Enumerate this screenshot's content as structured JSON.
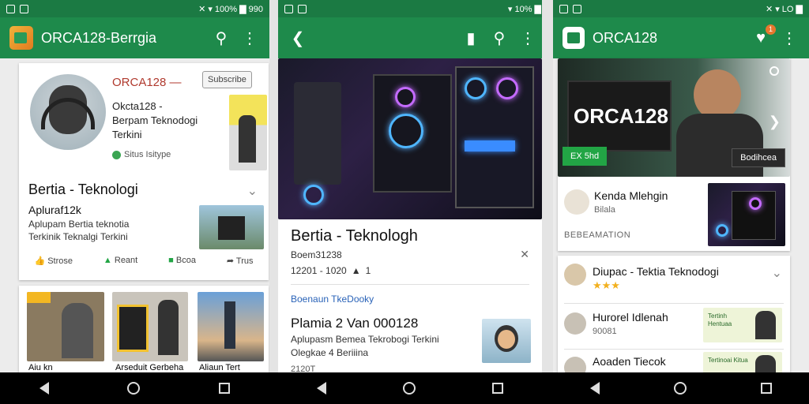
{
  "status": {
    "left_time": "",
    "p1_right": "✕ ▾ 100% ▇ 990",
    "p2_right": "▾ 10% ▇",
    "p3_right": "✕ ▾ LO ▇"
  },
  "panel1": {
    "app_title": "ORCA128-Berrgia",
    "profile": {
      "name": "ORCA128 —",
      "follow_label": "Subscribe",
      "line1": "Okcta128 -",
      "line2": "Berpam Teknodogi",
      "line3": "Terkini",
      "link": "Situs Isitype"
    },
    "headline": "Bertia - Teknologi",
    "article": {
      "title": "Apluraf12k",
      "line1": "Aplupam Bertia teknotia",
      "line2": "Terkinik Teknalgi Terkini"
    },
    "actions": [
      {
        "label": "Strose"
      },
      {
        "label": "Reant"
      },
      {
        "label": "Bcoa"
      },
      {
        "label": "Trus"
      }
    ],
    "tiles": [
      {
        "caption": "Aiu kn"
      },
      {
        "caption": "Arseduit Gerbeha"
      },
      {
        "caption": "Aliaun Tert"
      }
    ]
  },
  "panel2": {
    "headline": "Bertia - Teknologh",
    "meta1": "Boem31238",
    "meta2": "12201 - 1020",
    "meta2_count": "1",
    "link": "Boenaun TkeDooky",
    "article": {
      "title": "Plamia 2 Van 000128",
      "line1": "Aplupasm Bemea Tekrobogi Terkini",
      "line2": "Olegkae 4 Beriiina",
      "date": "2120T"
    }
  },
  "panel3": {
    "app_title": "ORCA128",
    "badge": "1",
    "hero": {
      "title": "ORCA128",
      "green_button": "EX 5hd",
      "dark_button": "Bodihcea"
    },
    "news1": {
      "title": "Kenda Mlehgin",
      "sub": "Bilala",
      "section": "BEBEAMATION"
    },
    "list_header": {
      "title": "Diupac - Tektia Teknodogi",
      "stars": "★★★"
    },
    "list": [
      {
        "title": "Hurorel Idlenah",
        "sub": "90081",
        "thumb_text": "Tertinh Hentuaa"
      },
      {
        "title": "Aoaden Tiecok",
        "sub": "",
        "thumb_text": "Tertinoai Kitua"
      }
    ]
  },
  "colors": {
    "appbar": "#1e8a4b",
    "statusbar": "#1b7a43",
    "accent_green": "#22a545"
  }
}
